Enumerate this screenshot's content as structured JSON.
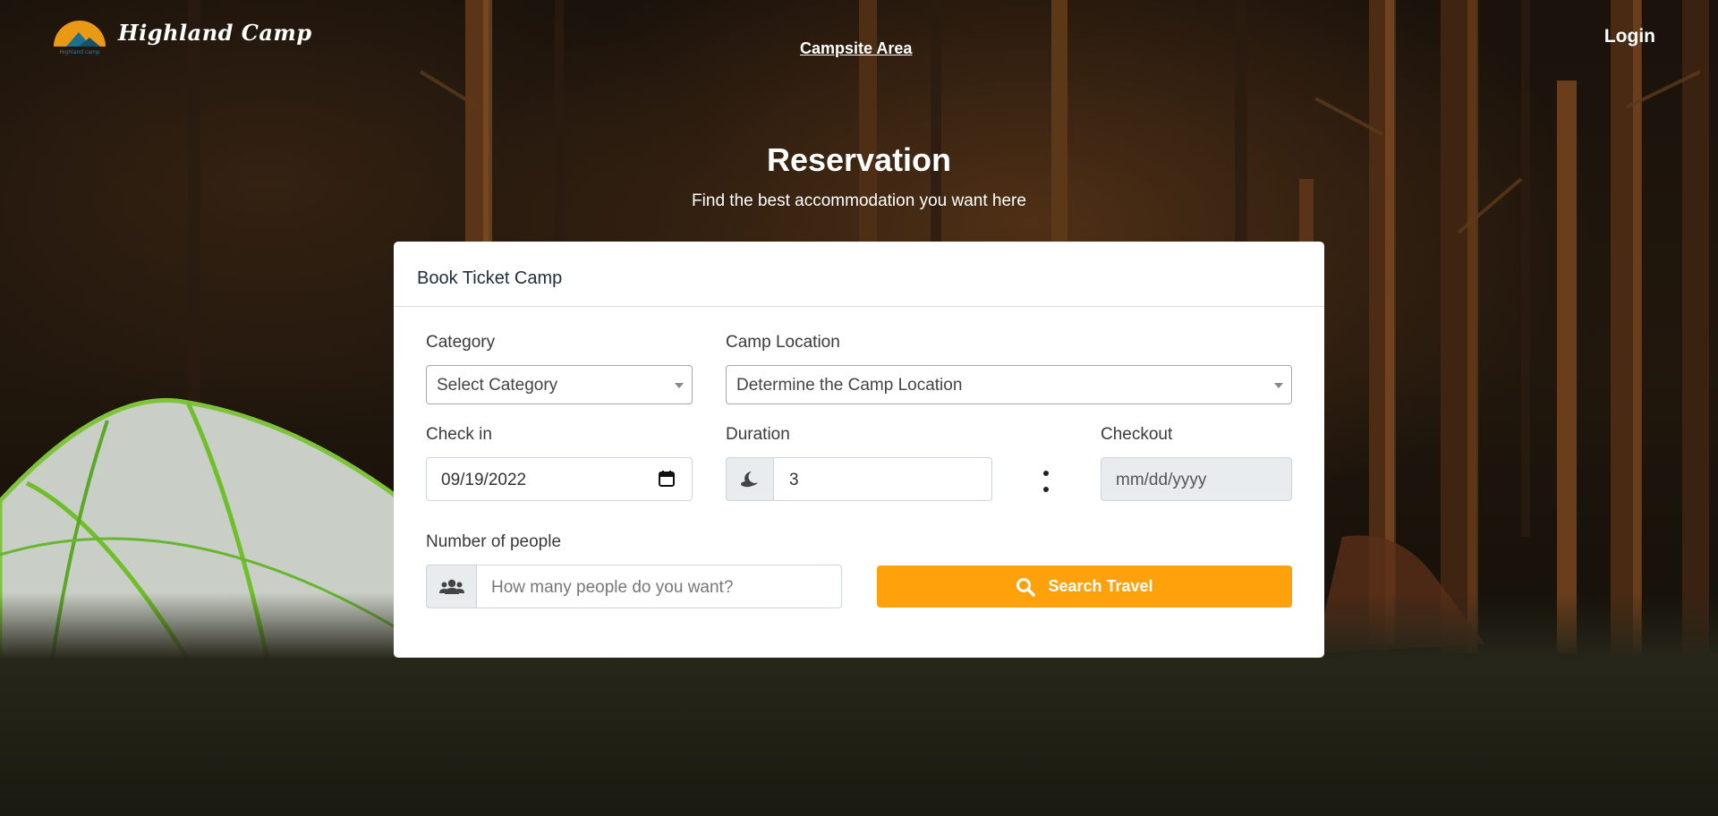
{
  "brand": {
    "name": "Highland Camp",
    "logo_text": "Highland camp"
  },
  "nav": {
    "campsite_area": "Campsite Area",
    "login": "Login"
  },
  "hero": {
    "title": "Reservation",
    "subtitle": "Find the best accommodation you want here"
  },
  "form": {
    "card_title": "Book Ticket Camp",
    "category": {
      "label": "Category",
      "value": "Select Category"
    },
    "camp_location": {
      "label": "Camp Location",
      "value": "Determine the Camp Location"
    },
    "check_in": {
      "label": "Check in",
      "value": "09/19/2022"
    },
    "duration": {
      "label": "Duration",
      "value": "3",
      "icon": "moon-icon"
    },
    "checkout": {
      "label": "Checkout",
      "placeholder": "mm/dd/yyyy"
    },
    "people": {
      "label": "Number of people",
      "placeholder": "How many people do you want?",
      "icon": "users-icon"
    },
    "search_button": "Search Travel"
  },
  "colors": {
    "accent": "#ffa10a",
    "card_bg": "#ffffff",
    "addon_bg": "#e9ecef"
  }
}
